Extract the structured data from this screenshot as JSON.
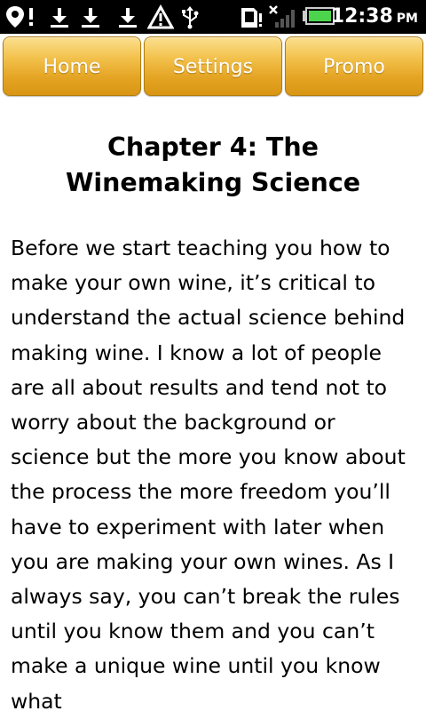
{
  "status_bar": {
    "icons": [
      "location-alert-icon",
      "download-icon",
      "download-icon",
      "download-icon",
      "warning-icon",
      "usb-icon",
      "sd-card-icon",
      "no-signal-icon",
      "battery-icon"
    ],
    "time": "12:38",
    "ampm": "PM",
    "battery_color": "#4cd44c"
  },
  "nav": {
    "tabs": [
      {
        "label": "Home"
      },
      {
        "label": "Settings"
      },
      {
        "label": "Promo"
      }
    ],
    "accent": "#f3c24d"
  },
  "content": {
    "title": "Chapter 4: The Winemaking Science",
    "body": "Before we start teaching you how to make your own wine, it’s critical to understand the actual science behind making wine. I know a lot of people are all about results and tend not to worry about the background or science but the more you know about the process the more freedom you’ll have to experiment with later when you are making your own wines. As I always say, you can’t break the rules until you know them and you can’t make a unique wine until you know what"
  }
}
